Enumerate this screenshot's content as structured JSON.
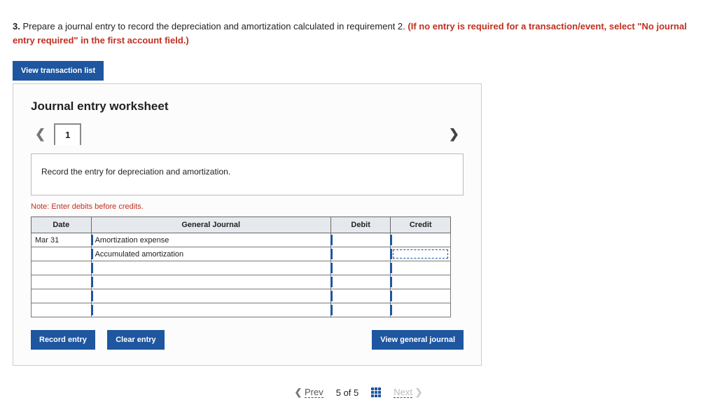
{
  "question": {
    "number": "3.",
    "text_a": " Prepare a journal entry to record the depreciation and amortization calculated in requirement 2. ",
    "text_red": "(If no entry is required for a transaction/event, select \"No journal entry required\" in the first account field.)"
  },
  "buttons": {
    "view_transaction_list": "View transaction list",
    "record_entry": "Record entry",
    "clear_entry": "Clear entry",
    "view_general_journal": "View general journal"
  },
  "worksheet": {
    "title": "Journal entry worksheet",
    "step": "1",
    "instruction": "Record the entry for depreciation and amortization.",
    "note": "Note: Enter debits before credits.",
    "headers": {
      "date": "Date",
      "gj": "General Journal",
      "debit": "Debit",
      "credit": "Credit"
    },
    "rows": [
      {
        "date": "Mar 31",
        "account": "Amortization expense"
      },
      {
        "date": "",
        "account": "Accumulated amortization"
      },
      {
        "date": "",
        "account": ""
      },
      {
        "date": "",
        "account": ""
      },
      {
        "date": "",
        "account": ""
      },
      {
        "date": "",
        "account": ""
      }
    ]
  },
  "footer": {
    "prev": "Prev",
    "pos_current": "5",
    "pos_of": " of ",
    "pos_total": "5",
    "next": "Next"
  }
}
